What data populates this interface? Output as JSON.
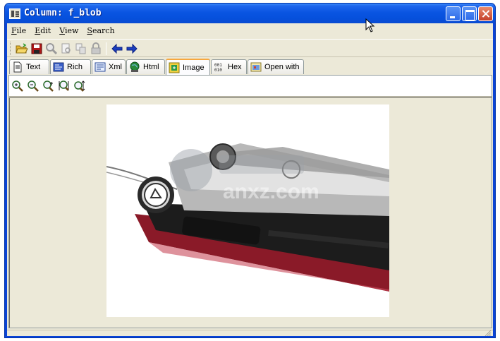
{
  "window": {
    "title": "Column: f_blob"
  },
  "menu": [
    {
      "label": "File",
      "key": "F",
      "rest": "ile"
    },
    {
      "label": "Edit",
      "key": "E",
      "rest": "dit"
    },
    {
      "label": "View",
      "key": "V",
      "rest": "iew"
    },
    {
      "label": "Search",
      "key": "S",
      "rest": "earch"
    }
  ],
  "toolbar": {
    "icons": [
      "open-folder-icon",
      "save-icon",
      "find-icon",
      "print-preview-icon",
      "copy-icon",
      "lock-icon",
      "back-arrow-icon",
      "forward-arrow-icon"
    ]
  },
  "tabs": [
    {
      "label": "Text",
      "icon": "text-page-icon"
    },
    {
      "label": "Rich",
      "icon": "rich-text-icon"
    },
    {
      "label": "Xml",
      "icon": "xml-icon"
    },
    {
      "label": "Html",
      "icon": "html-globe-icon"
    },
    {
      "label": "Image",
      "icon": "image-icon",
      "active": true
    },
    {
      "label": "Hex",
      "icon": "hex-icon"
    },
    {
      "label": "Open with",
      "icon": "open-with-icon"
    }
  ],
  "zoom": {
    "icons": [
      "zoom-in-icon",
      "zoom-out-icon",
      "zoom-fit-icon",
      "zoom-actual-icon",
      "zoom-stretch-icon"
    ]
  },
  "image": {
    "description_icon": "phone-photo",
    "watermark": "anxz.com"
  },
  "colors": {
    "title_bar": "#0a55e2",
    "face": "#ece9d8",
    "active_tab_accent": "#f7a840"
  }
}
